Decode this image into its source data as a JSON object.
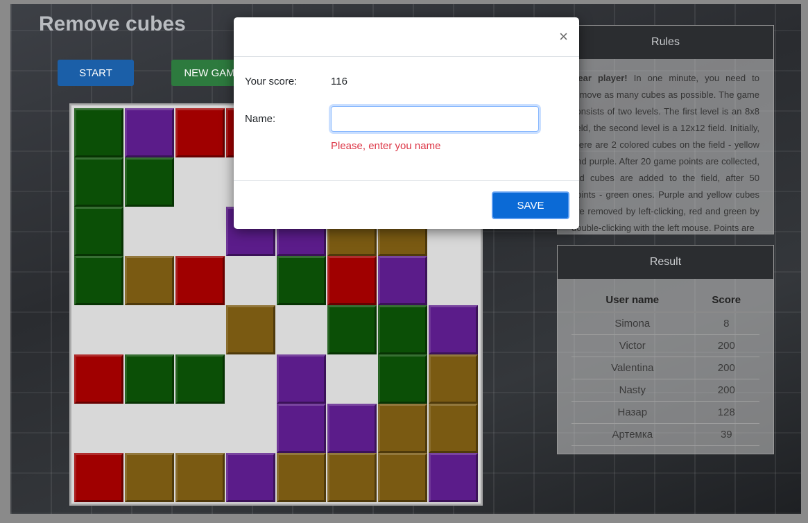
{
  "app": {
    "title": "Remove cubes",
    "start_label": "START",
    "new_game_label": "NEW GAME"
  },
  "board": {
    "rows": [
      [
        "green",
        "purple",
        "red",
        "red",
        "empty",
        "empty",
        "empty",
        "empty"
      ],
      [
        "green",
        "green",
        "empty",
        "empty",
        "empty",
        "empty",
        "empty",
        "empty"
      ],
      [
        "green",
        "empty",
        "empty",
        "purple",
        "purple",
        "yellow",
        "yellow",
        "empty"
      ],
      [
        "green",
        "yellow",
        "red",
        "empty",
        "green",
        "red",
        "purple",
        "empty"
      ],
      [
        "empty",
        "empty",
        "empty",
        "yellow",
        "empty",
        "green",
        "green",
        "purple"
      ],
      [
        "red",
        "green",
        "green",
        "empty",
        "purple",
        "empty",
        "green",
        "yellow"
      ],
      [
        "empty",
        "empty",
        "empty",
        "empty",
        "purple",
        "purple",
        "yellow",
        "yellow"
      ],
      [
        "red",
        "yellow",
        "yellow",
        "purple",
        "yellow",
        "yellow",
        "yellow",
        "purple"
      ]
    ]
  },
  "rules": {
    "title": "Rules",
    "lead": "Dear player!",
    "text": " In one minute, you need to remove as many cubes as possible. The game consists of two levels. The first level is an 8x8 field, the second level is a 12x12 field. Initially, there are 2 colored cubes on the field - yellow and purple. After 20 game points are collected, red cubes are added to the field, after 50 points - green ones. Purple and yellow cubes are removed by left-clicking, red and green by double-clicking with the left mouse. Points are"
  },
  "result": {
    "title": "Result",
    "col_user": "User name",
    "col_score": "Score",
    "rows": [
      {
        "name": "Simona",
        "score": "8"
      },
      {
        "name": "Victor",
        "score": "200"
      },
      {
        "name": "Valentina",
        "score": "200"
      },
      {
        "name": "Nasty",
        "score": "200"
      },
      {
        "name": "Назар",
        "score": "128"
      },
      {
        "name": "Артемка",
        "score": "39"
      }
    ]
  },
  "modal": {
    "close_symbol": "×",
    "score_label": "Your score:",
    "score_value": "116",
    "name_label": "Name:",
    "name_value": "",
    "error": "Please, enter you name",
    "save_label": "SAVE"
  }
}
